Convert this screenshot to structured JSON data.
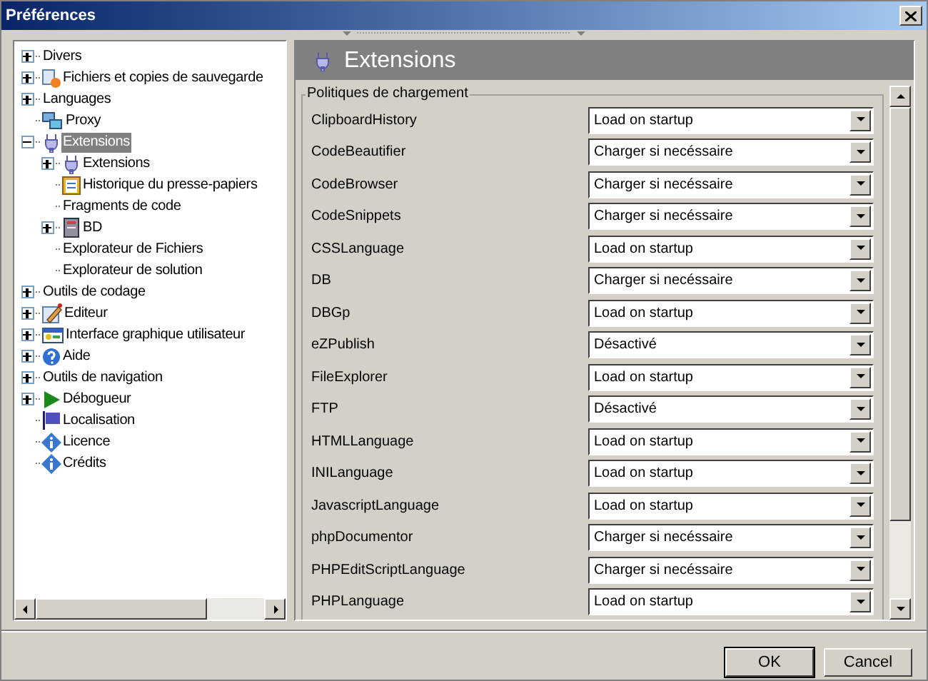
{
  "window": {
    "title": "Préférences"
  },
  "tree": [
    {
      "label": "Divers",
      "kind": "node",
      "expanded": false,
      "selected": false
    },
    {
      "label": "Fichiers et copies de sauvegarde",
      "kind": "node",
      "expanded": false,
      "selected": false
    },
    {
      "label": "Languages",
      "kind": "node",
      "expanded": false,
      "selected": false
    },
    {
      "label": "Proxy",
      "kind": "leaf",
      "selected": false
    },
    {
      "label": "Extensions",
      "kind": "node",
      "expanded": true,
      "selected": true,
      "children": [
        {
          "label": "Extensions",
          "kind": "node",
          "expanded": false,
          "selected": false
        },
        {
          "label": "Historique du presse-papiers",
          "kind": "leaf",
          "selected": false
        },
        {
          "label": "Fragments de code",
          "kind": "leaf",
          "selected": false
        },
        {
          "label": "BD",
          "kind": "node",
          "expanded": false,
          "selected": false
        },
        {
          "label": "Explorateur de Fichiers",
          "kind": "leaf",
          "selected": false
        },
        {
          "label": "Explorateur de solution",
          "kind": "leaf",
          "selected": false
        }
      ]
    },
    {
      "label": "Outils de codage",
      "kind": "node",
      "expanded": false,
      "selected": false
    },
    {
      "label": "Editeur",
      "kind": "node",
      "expanded": false,
      "selected": false
    },
    {
      "label": "Interface graphique utilisateur",
      "kind": "node",
      "expanded": false,
      "selected": false
    },
    {
      "label": "Aide",
      "kind": "node",
      "expanded": false,
      "selected": false
    },
    {
      "label": "Outils de navigation",
      "kind": "node",
      "expanded": false,
      "selected": false
    },
    {
      "label": "Débogueur",
      "kind": "node",
      "expanded": false,
      "selected": false
    },
    {
      "label": "Localisation",
      "kind": "leaf",
      "selected": false
    },
    {
      "label": "Licence",
      "kind": "leaf",
      "selected": false
    },
    {
      "label": "Crédits",
      "kind": "leaf",
      "selected": false
    }
  ],
  "panel": {
    "title": "Extensions",
    "group": "Politiques de chargement",
    "rows": [
      {
        "name": "ClipboardHistory",
        "value": "Load on startup"
      },
      {
        "name": "CodeBeautifier",
        "value": "Charger si necéssaire"
      },
      {
        "name": "CodeBrowser",
        "value": "Charger si necéssaire"
      },
      {
        "name": "CodeSnippets",
        "value": "Charger si necéssaire"
      },
      {
        "name": "CSSLanguage",
        "value": "Load on startup"
      },
      {
        "name": "DB",
        "value": "Charger si necéssaire"
      },
      {
        "name": "DBGp",
        "value": "Load on startup"
      },
      {
        "name": "eZPublish",
        "value": "Désactivé"
      },
      {
        "name": "FileExplorer",
        "value": "Load on startup"
      },
      {
        "name": "FTP",
        "value": "Désactivé"
      },
      {
        "name": "HTMLLanguage",
        "value": "Load on startup"
      },
      {
        "name": "INILanguage",
        "value": "Load on startup"
      },
      {
        "name": "JavascriptLanguage",
        "value": "Load on startup"
      },
      {
        "name": "phpDocumentor",
        "value": "Charger si necéssaire"
      },
      {
        "name": "PHPEditScriptLanguage",
        "value": "Charger si necéssaire"
      },
      {
        "name": "PHPLanguage",
        "value": "Load on startup"
      }
    ]
  },
  "buttons": [
    "OK",
    "Cancel"
  ]
}
